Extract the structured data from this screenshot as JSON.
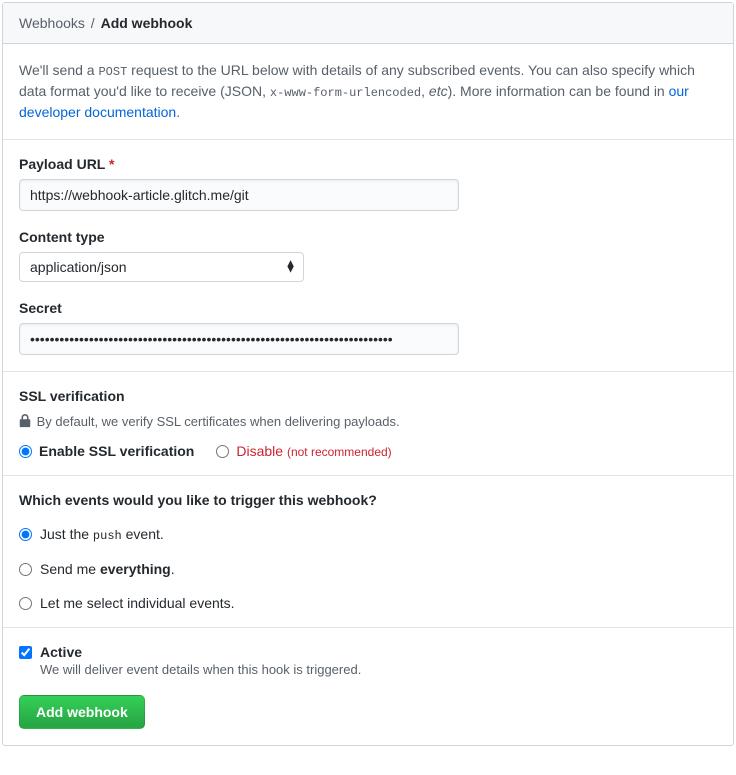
{
  "breadcrumb": {
    "parent": "Webhooks",
    "separator": "/",
    "current": "Add webhook"
  },
  "intro": {
    "part1": "We'll send a ",
    "post": "POST",
    "part2": " request to the URL below with details of any subscribed events. You can also specify which data format you'd like to receive (JSON, ",
    "urlencoded": "x-www-form-urlencoded",
    "part3": ", ",
    "etc": "etc",
    "part4": "). More information can be found in ",
    "link": "our developer documentation",
    "part5": "."
  },
  "fields": {
    "payload_url": {
      "label": "Payload URL",
      "required": "*",
      "value": "https://webhook-article.glitch.me/git"
    },
    "content_type": {
      "label": "Content type",
      "selected": "application/json"
    },
    "secret": {
      "label": "Secret",
      "value": "••••••••••••••••••••••••••••••••••••••••••••••••••••••••••••••••••••••••••"
    }
  },
  "ssl": {
    "heading": "SSL verification",
    "note": "By default, we verify SSL certificates when delivering payloads.",
    "enable_label": "Enable SSL verification",
    "disable_label": "Disable",
    "disable_note": "(not recommended)"
  },
  "events": {
    "heading": "Which events would you like to trigger this webhook?",
    "just_push_pre": "Just the ",
    "just_push_code": "push",
    "just_push_post": " event.",
    "everything_pre": "Send me ",
    "everything_strong": "everything",
    "everything_post": ".",
    "individual": "Let me select individual events."
  },
  "active": {
    "label": "Active",
    "desc": "We will deliver event details when this hook is triggered."
  },
  "submit": {
    "label": "Add webhook"
  }
}
